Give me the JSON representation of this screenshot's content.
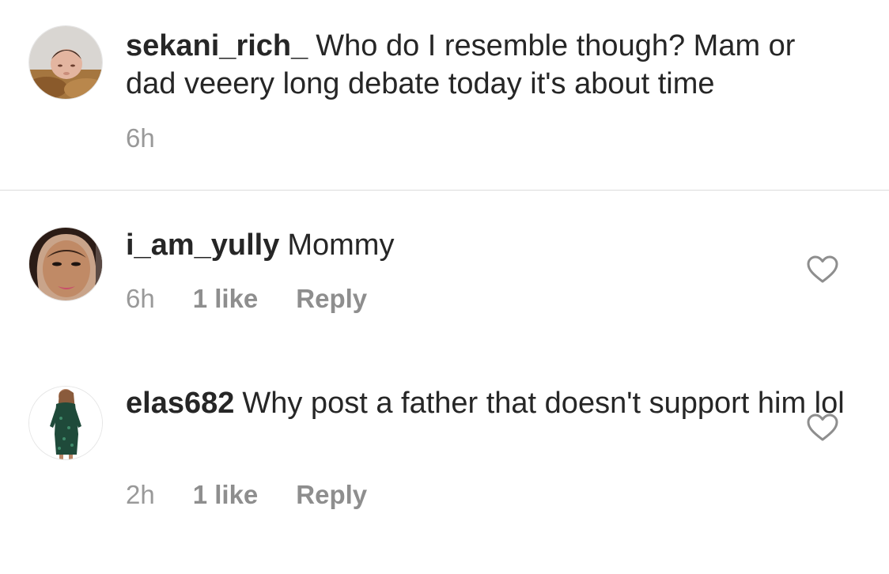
{
  "caption": {
    "username": "sekani_rich_",
    "text": "Who do I resemble though? Mam or dad veeery long debate today it's about time",
    "time": "6h",
    "avatar_icon": "baby-photo-avatar"
  },
  "comments": [
    {
      "username": "i_am_yully",
      "text": "Mommy",
      "time": "6h",
      "likes": "1 like",
      "reply_label": "Reply",
      "avatar_icon": "woman-face-avatar",
      "like_icon": "heart-outline-icon"
    },
    {
      "username": "elas682",
      "text": "Why post a father that doesn't support him lol",
      "time": "2h",
      "likes": "1 like",
      "reply_label": "Reply",
      "avatar_icon": "woman-green-dress-avatar",
      "like_icon": "heart-outline-icon"
    }
  ],
  "colors": {
    "text": "#262626",
    "meta": "#8e8e8e",
    "divider": "#dbdbdb",
    "background": "#ffffff"
  }
}
